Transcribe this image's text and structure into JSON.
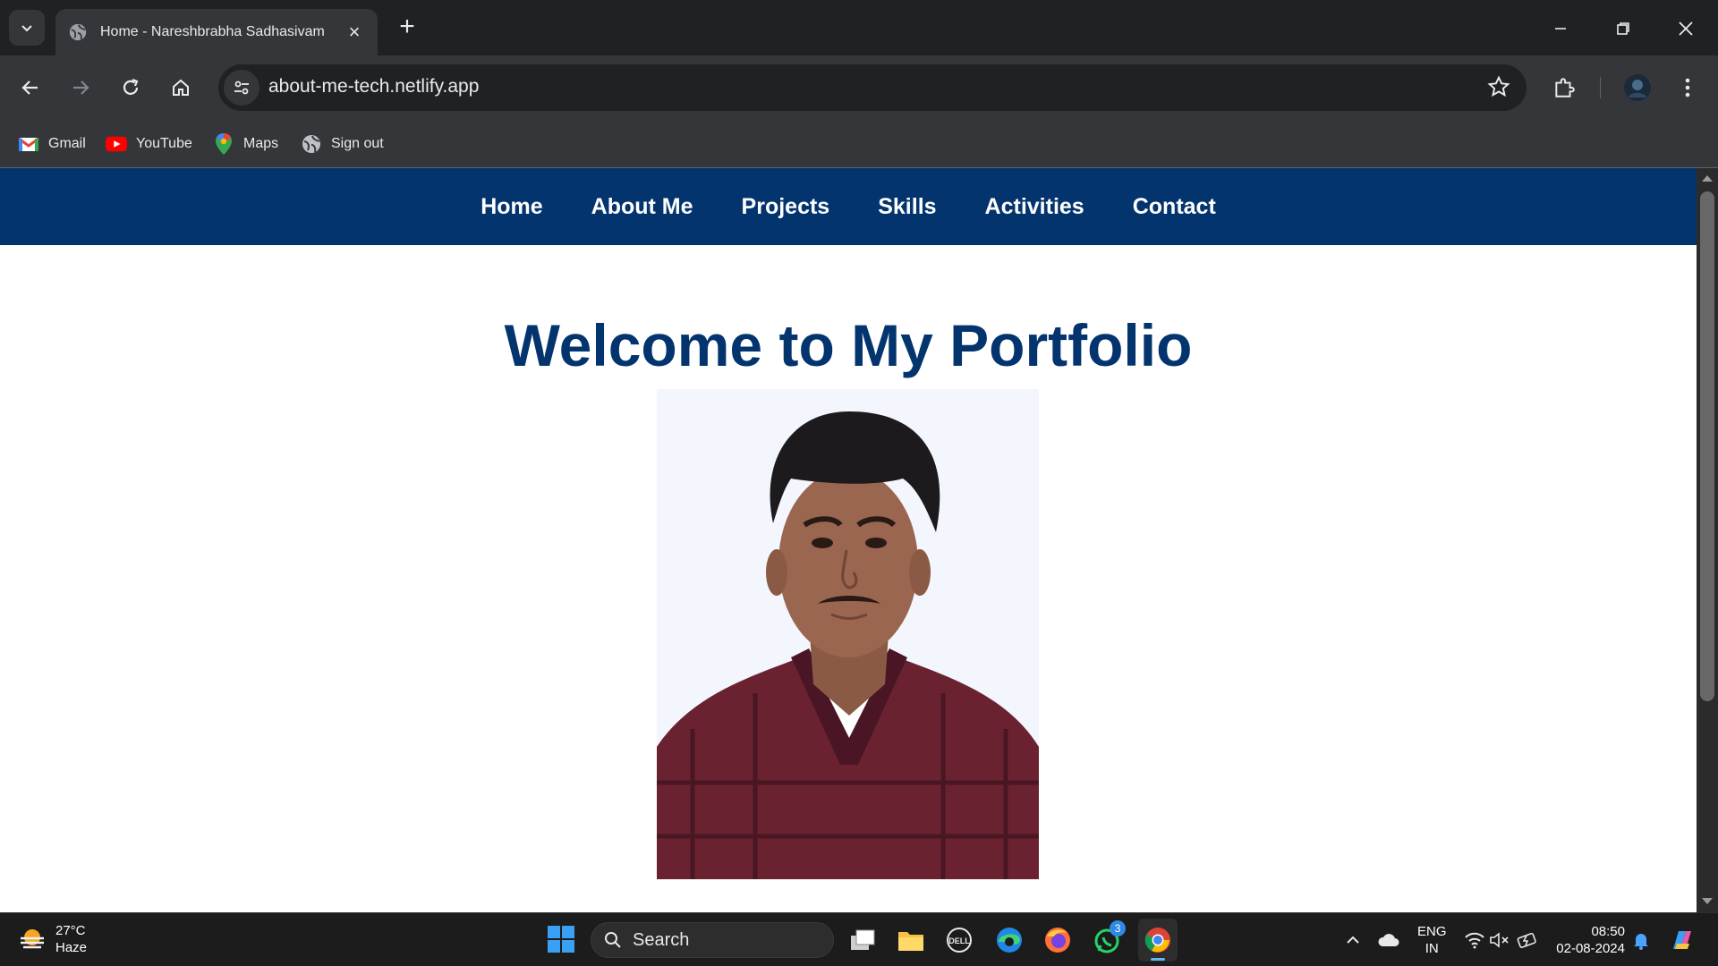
{
  "browser": {
    "tab": {
      "title": "Home - Nareshbrabha Sadhasivam"
    },
    "address_bar": {
      "url": "about-me-tech.netlify.app"
    },
    "bookmarks": [
      {
        "label": "Gmail",
        "icon": "gmail-icon"
      },
      {
        "label": "YouTube",
        "icon": "youtube-icon"
      },
      {
        "label": "Maps",
        "icon": "maps-icon"
      },
      {
        "label": "Sign out",
        "icon": "globe-icon"
      }
    ]
  },
  "site": {
    "nav": [
      "Home",
      "About Me",
      "Projects",
      "Skills",
      "Activities",
      "Contact"
    ],
    "hero_title": "Welcome to My Portfolio",
    "colors": {
      "nav_bg": "#03346e",
      "title": "#03346e"
    }
  },
  "taskbar": {
    "weather": {
      "temp": "27°C",
      "condition": "Haze"
    },
    "search_label": "Search",
    "language": {
      "line1": "ENG",
      "line2": "IN"
    },
    "clock": {
      "time": "08:50",
      "date": "02-08-2024"
    },
    "whatsapp_badge": "3"
  }
}
